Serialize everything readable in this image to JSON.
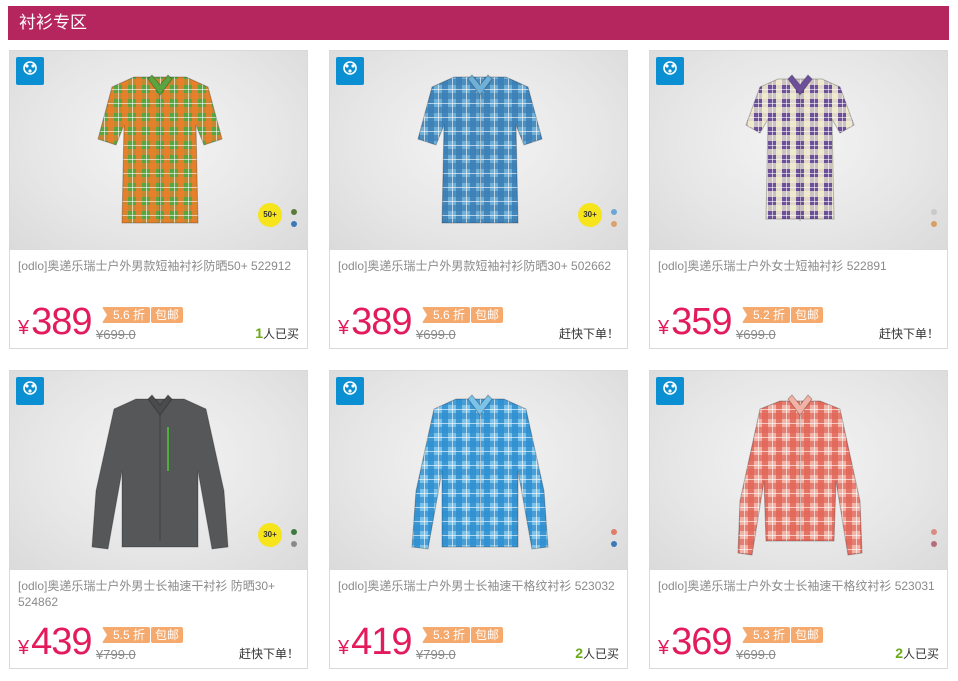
{
  "section": {
    "title": "衬衫专区"
  },
  "brand": {
    "logo_text": "odlo"
  },
  "products": [
    {
      "title": "[odlo]奥递乐瑞士户外男款短袖衬衫防晒50+ 522912",
      "currency": "¥",
      "price": "389",
      "discount": "5.6 折",
      "shipping": "包邮",
      "original_price": "¥699.0",
      "sold_count": "1",
      "sold_suffix": "人已买",
      "status": "",
      "spf": "50+",
      "shirt_colors": [
        "#ef7d2a",
        "#5aa540"
      ],
      "swatches": [
        "#5c7a3a",
        "#3a7ab8"
      ]
    },
    {
      "title": "[odlo]奥递乐瑞士户外男款短袖衬衫防晒30+ 502662",
      "currency": "¥",
      "price": "389",
      "discount": "5.6 折",
      "shipping": "包邮",
      "original_price": "¥699.0",
      "sold_count": "",
      "sold_suffix": "",
      "status": "赶快下单！",
      "spf": "30+",
      "shirt_colors": [
        "#3b7fb6",
        "#6fb0d8"
      ],
      "swatches": [
        "#6ba6d6",
        "#d8a26a"
      ]
    },
    {
      "title": "[odlo]奥递乐瑞士户外女士短袖衬衫 522891",
      "currency": "¥",
      "price": "359",
      "discount": "5.2 折",
      "shipping": "包邮",
      "original_price": "¥699.0",
      "sold_count": "",
      "sold_suffix": "",
      "status": "赶快下单！",
      "spf": "",
      "shirt_colors": [
        "#f5f1d2",
        "#6d4f9a"
      ],
      "swatches": [
        "#c9c9c9",
        "#d7a063"
      ]
    },
    {
      "title": "[odlo]奥递乐瑞士户外男士长袖速干衬衫 防晒30+ 524862",
      "currency": "¥",
      "price": "439",
      "discount": "5.5 折",
      "shipping": "包邮",
      "original_price": "¥799.0",
      "sold_count": "",
      "sold_suffix": "",
      "status": "赶快下单！",
      "spf": "30+",
      "shirt_colors": [
        "#555759",
        "#6a6c6e"
      ],
      "swatches": [
        "#3e7a3e",
        "#8a8a8a"
      ]
    },
    {
      "title": "[odlo]奥递乐瑞士户外男士长袖速干格纹衬衫 523032",
      "currency": "¥",
      "price": "419",
      "discount": "5.3 折",
      "shipping": "包邮",
      "original_price": "¥799.0",
      "sold_count": "2",
      "sold_suffix": "人已买",
      "status": "",
      "spf": "",
      "shirt_colors": [
        "#2f8fd0",
        "#7cc3ea"
      ],
      "swatches": [
        "#e07c6a",
        "#3a7ab8"
      ]
    },
    {
      "title": "[odlo]奥递乐瑞士户外女士长袖速干格纹衬衫 523031",
      "currency": "¥",
      "price": "369",
      "discount": "5.3 折",
      "shipping": "包邮",
      "original_price": "¥699.0",
      "sold_count": "2",
      "sold_suffix": "人已买",
      "status": "",
      "spf": "",
      "shirt_colors": [
        "#e2675a",
        "#f3b2a6"
      ],
      "swatches": [
        "#d98c84",
        "#b4707a"
      ]
    }
  ]
}
